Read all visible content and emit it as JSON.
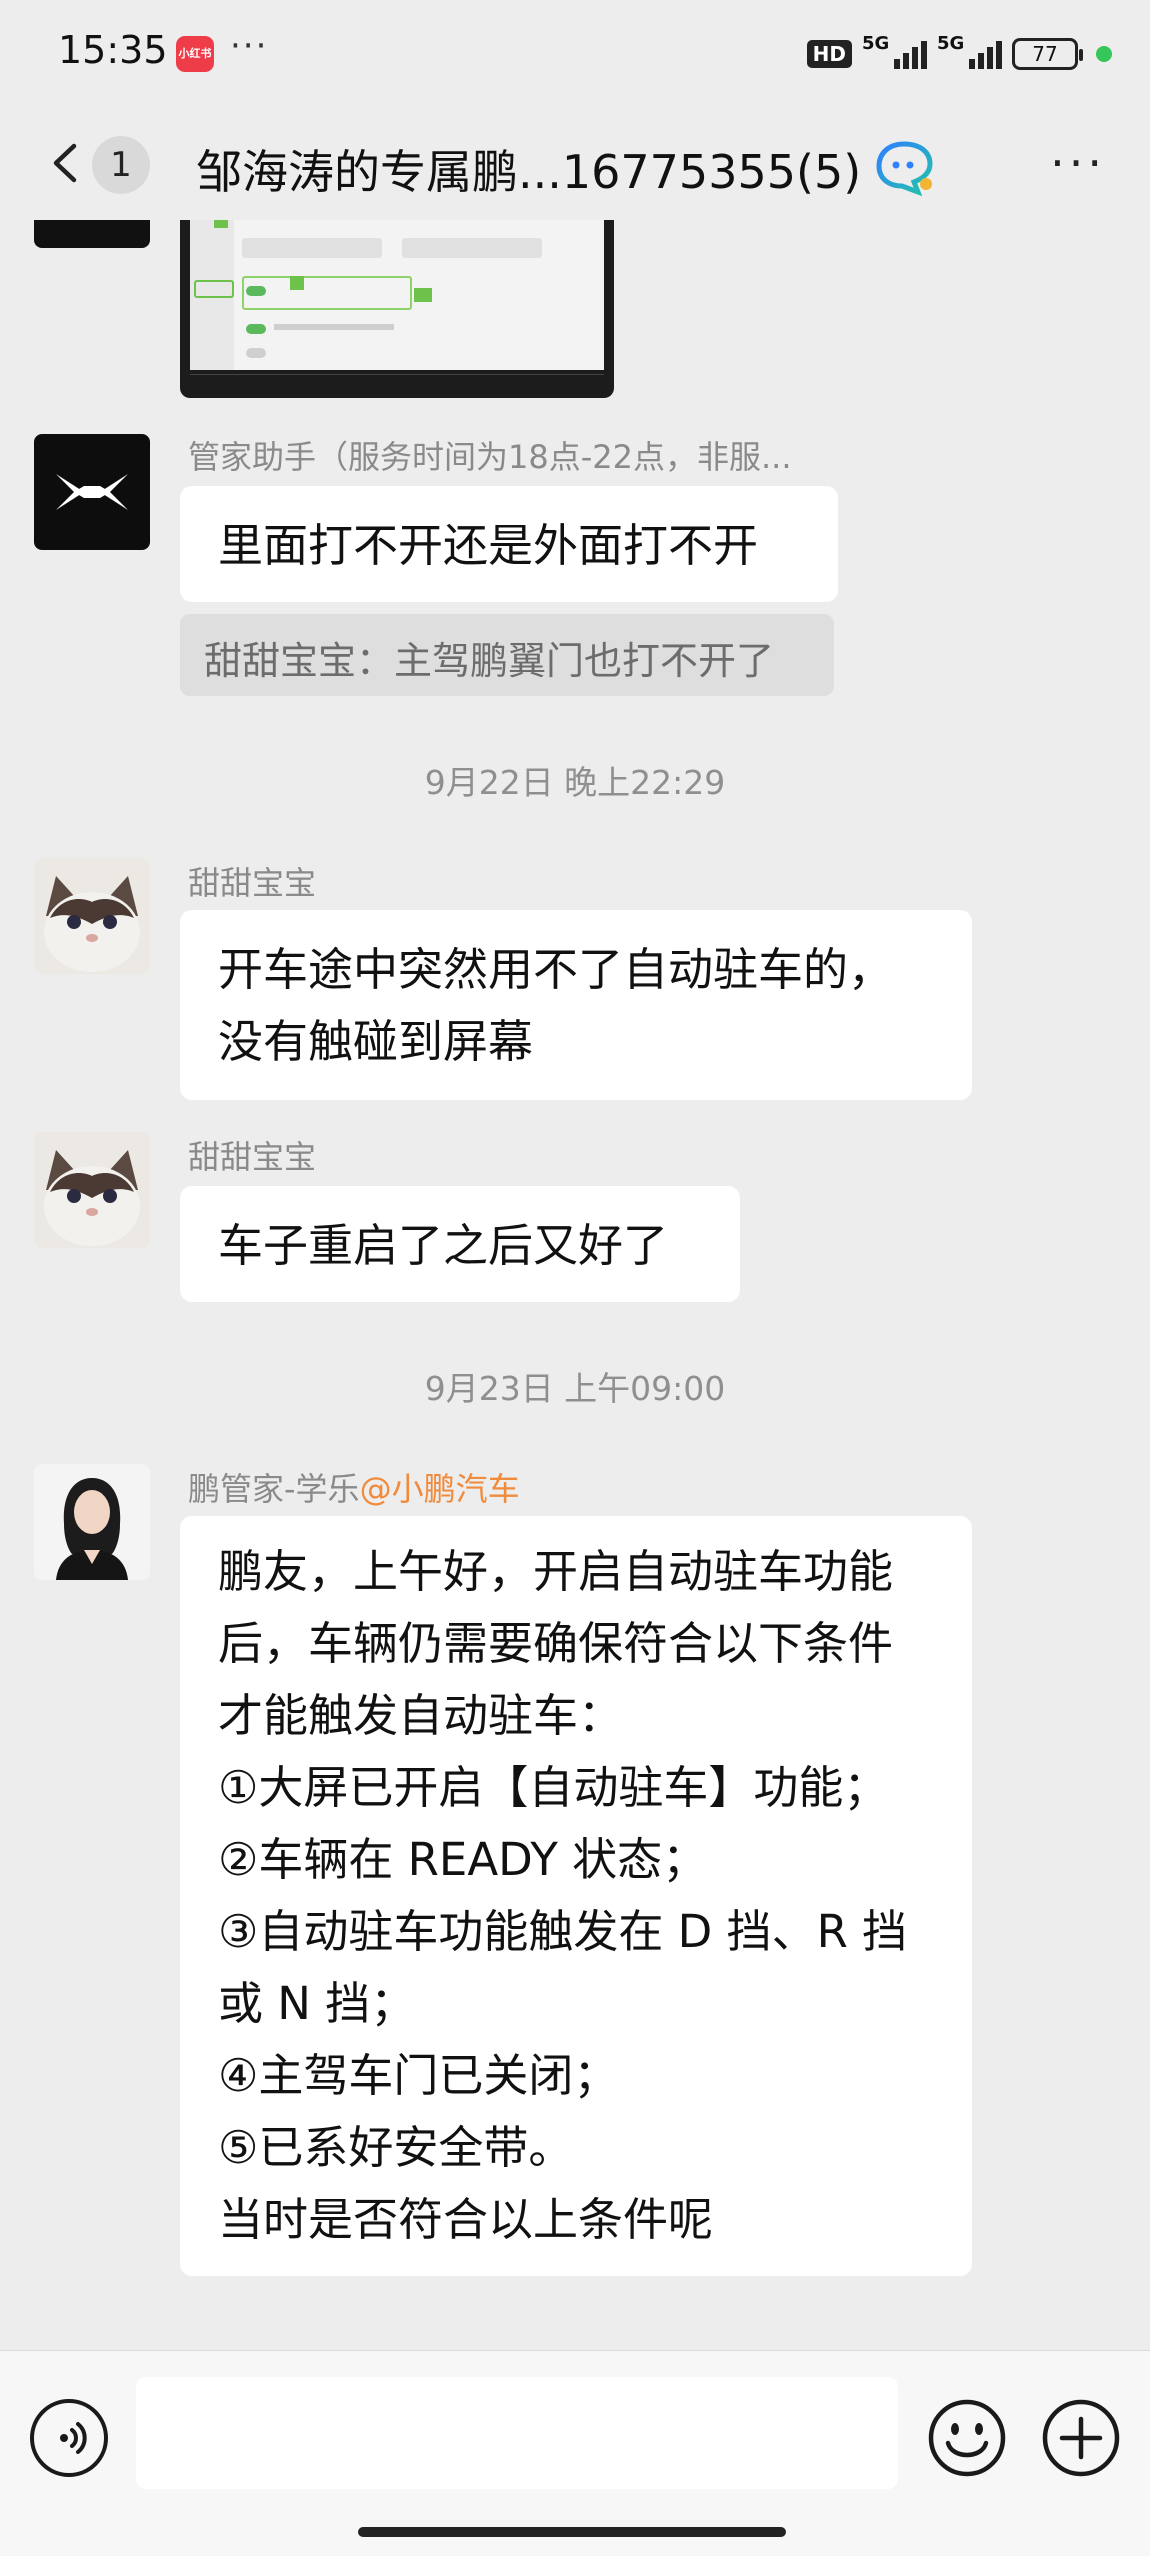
{
  "status_bar": {
    "time": "15:35",
    "app_icon_text": "小红书",
    "dots": "···",
    "hd_label": "HD",
    "signal1_label": "5G",
    "signal2_label": "5G",
    "battery": "77"
  },
  "header": {
    "unread_count": "1",
    "title": "邹海涛的专属鹏...16775355(5)"
  },
  "messages": [
    {
      "sender": "管家助手（服务时间为18点-22点，非服...",
      "text": "里面打不开还是外面打不开",
      "quote": "甜甜宝宝：主驾鹏翼门也打不开了"
    },
    {
      "timestamp": "9月22日 晚上22:29"
    },
    {
      "sender": "甜甜宝宝",
      "text_lines": [
        "开车途中突然用不了自动驻车的，",
        "没有触碰到屏幕"
      ]
    },
    {
      "sender": "甜甜宝宝",
      "text": "车子重启了之后又好了"
    },
    {
      "timestamp": "9月23日 上午09:00"
    },
    {
      "sender": "鹏管家-学乐",
      "sender_org": "@小鹏汽车",
      "text_lines": [
        "鹏友，上午好，开启自动驻车功能",
        "后，车辆仍需要确保符合以下条件",
        "才能触发自动驻车：",
        "①大屏已开启【自动驻车】功能；",
        "②车辆在 READY 状态；",
        "③自动驻车功能触发在 D 挡、R 挡",
        "或 N 挡；",
        "④主驾车门已关闭；",
        "⑤已系好安全带。",
        "当时是否符合以上条件呢"
      ]
    }
  ],
  "colors": {
    "background": "#ededed",
    "bubble": "#ffffff",
    "org_accent": "#f08a3c",
    "meta_text": "#8a8a8a"
  }
}
